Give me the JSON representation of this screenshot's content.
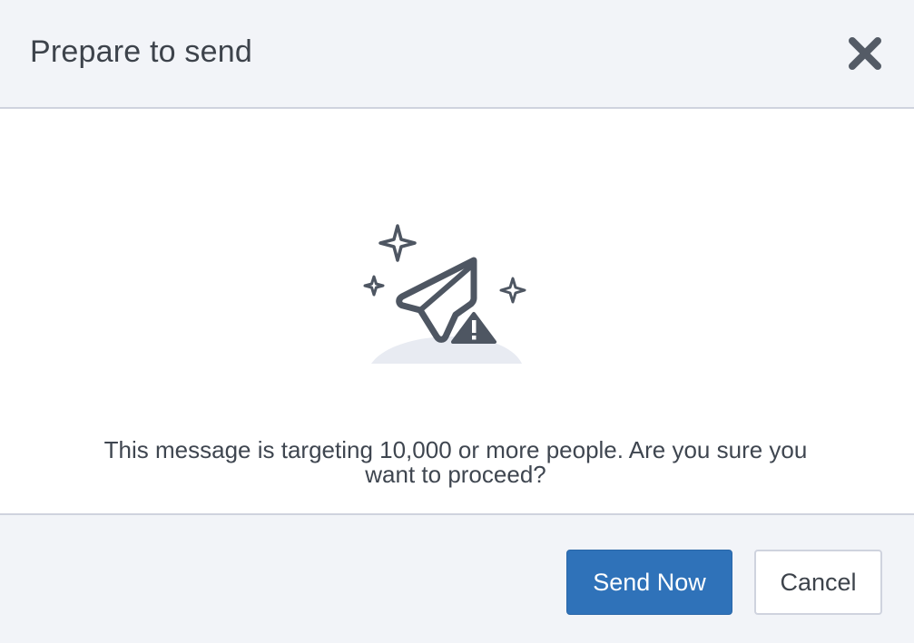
{
  "dialog": {
    "title": "Prepare to send",
    "close_icon": "close-icon",
    "illustration_icon": "paper-plane-warning-icon",
    "message": "This message is targeting 10,000 or more people. Are you sure you want to proceed?",
    "primary_button_label": "Send Now",
    "secondary_button_label": "Cancel"
  },
  "colors": {
    "header_bg": "#f2f4f8",
    "body_bg": "#ffffff",
    "divider": "#cfd3de",
    "primary": "#2f72b9",
    "text": "#3f4650",
    "icon": "#4e5662"
  }
}
